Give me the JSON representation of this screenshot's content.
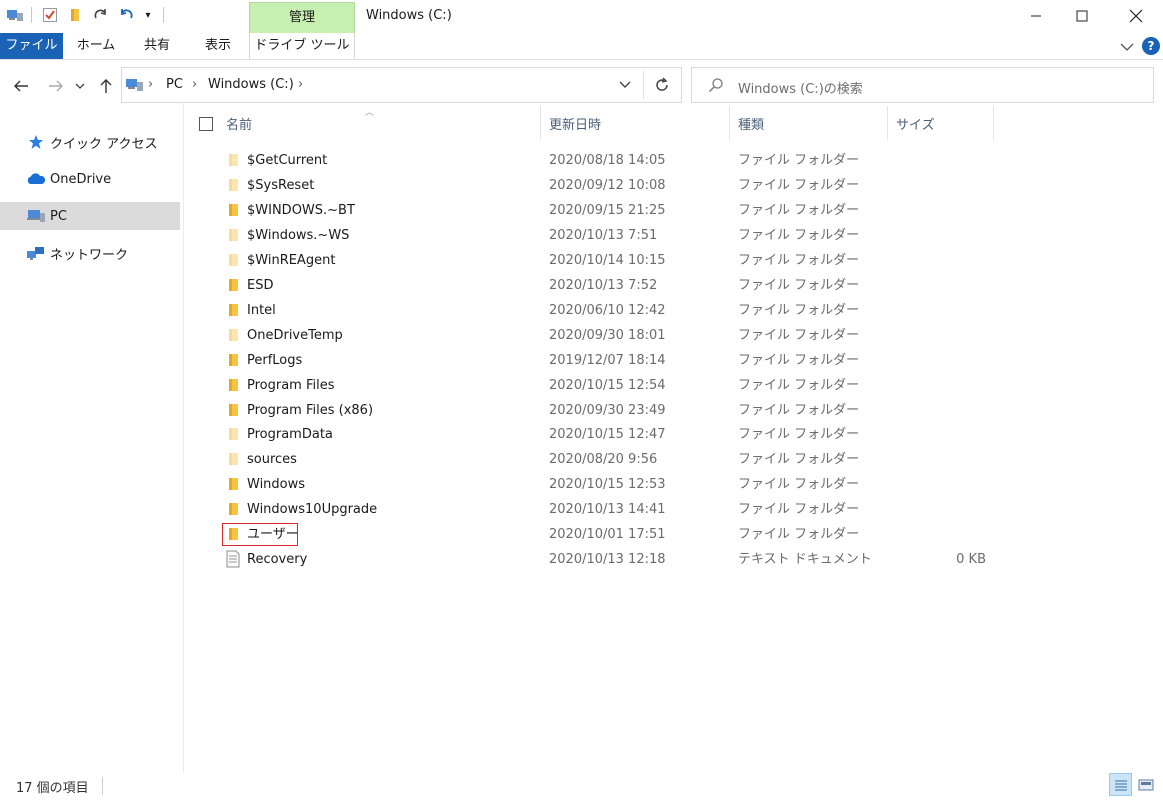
{
  "window": {
    "title": "Windows (C:)",
    "context_tab": "管理"
  },
  "ribbon": {
    "tabs": [
      "ファイル",
      "ホーム",
      "共有",
      "表示",
      "ドライブ ツール"
    ],
    "file_tab_color": "#1a62b6"
  },
  "address": {
    "crumbs": [
      "PC",
      "Windows (C:)"
    ]
  },
  "search": {
    "placeholder": "Windows (C:)の検索"
  },
  "sidebar": {
    "items": [
      {
        "label": "クイック アクセス",
        "icon": "star-icon"
      },
      {
        "label": "OneDrive",
        "icon": "cloud-icon"
      },
      {
        "label": "PC",
        "icon": "pc-icon",
        "selected": true
      },
      {
        "label": "ネットワーク",
        "icon": "network-icon"
      }
    ]
  },
  "columns": {
    "name": "名前",
    "date": "更新日時",
    "type": "種類",
    "size": "サイズ"
  },
  "files": [
    {
      "name": "$GetCurrent",
      "date": "2020/08/18 14:05",
      "type": "ファイル フォルダー",
      "size": "",
      "icon": "folder-faded-icon"
    },
    {
      "name": "$SysReset",
      "date": "2020/09/12 10:08",
      "type": "ファイル フォルダー",
      "size": "",
      "icon": "folder-faded-icon"
    },
    {
      "name": "$WINDOWS.~BT",
      "date": "2020/09/15 21:25",
      "type": "ファイル フォルダー",
      "size": "",
      "icon": "folder-icon"
    },
    {
      "name": "$Windows.~WS",
      "date": "2020/10/13 7:51",
      "type": "ファイル フォルダー",
      "size": "",
      "icon": "folder-faded-icon"
    },
    {
      "name": "$WinREAgent",
      "date": "2020/10/14 10:15",
      "type": "ファイル フォルダー",
      "size": "",
      "icon": "folder-faded-icon"
    },
    {
      "name": "ESD",
      "date": "2020/10/13 7:52",
      "type": "ファイル フォルダー",
      "size": "",
      "icon": "folder-icon"
    },
    {
      "name": "Intel",
      "date": "2020/06/10 12:42",
      "type": "ファイル フォルダー",
      "size": "",
      "icon": "folder-icon"
    },
    {
      "name": "OneDriveTemp",
      "date": "2020/09/30 18:01",
      "type": "ファイル フォルダー",
      "size": "",
      "icon": "folder-faded-icon"
    },
    {
      "name": "PerfLogs",
      "date": "2019/12/07 18:14",
      "type": "ファイル フォルダー",
      "size": "",
      "icon": "folder-icon"
    },
    {
      "name": "Program Files",
      "date": "2020/10/15 12:54",
      "type": "ファイル フォルダー",
      "size": "",
      "icon": "folder-icon"
    },
    {
      "name": "Program Files (x86)",
      "date": "2020/09/30 23:49",
      "type": "ファイル フォルダー",
      "size": "",
      "icon": "folder-icon"
    },
    {
      "name": "ProgramData",
      "date": "2020/10/15 12:47",
      "type": "ファイル フォルダー",
      "size": "",
      "icon": "folder-faded-icon"
    },
    {
      "name": "sources",
      "date": "2020/08/20 9:56",
      "type": "ファイル フォルダー",
      "size": "",
      "icon": "folder-faded-icon"
    },
    {
      "name": "Windows",
      "date": "2020/10/15 12:53",
      "type": "ファイル フォルダー",
      "size": "",
      "icon": "folder-icon"
    },
    {
      "name": "Windows10Upgrade",
      "date": "2020/10/13 14:41",
      "type": "ファイル フォルダー",
      "size": "",
      "icon": "folder-icon"
    },
    {
      "name": "ユーザー",
      "date": "2020/10/01 17:51",
      "type": "ファイル フォルダー",
      "size": "",
      "icon": "folder-icon",
      "highlighted": true
    },
    {
      "name": "Recovery",
      "date": "2020/10/13 12:18",
      "type": "テキスト ドキュメント",
      "size": "0 KB",
      "icon": "text-document-icon"
    }
  ],
  "status": {
    "item_count": "17 個の項目"
  },
  "colors": {
    "context_tab_bg": "#c7f0b0",
    "highlight_border": "#d62828",
    "folder_yellow": "#f6c342",
    "selected_sidebar_bg": "#dbdbdb"
  }
}
